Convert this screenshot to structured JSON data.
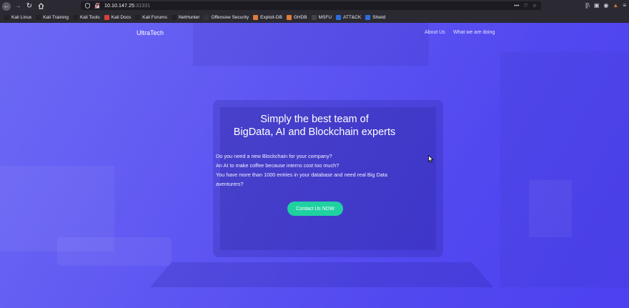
{
  "browser": {
    "url_host": "10.10.147.25",
    "url_port": ":31331",
    "bookmarks": [
      {
        "label": "Kali Linux",
        "icon": "kali-icon",
        "color": "#222222"
      },
      {
        "label": "Kali Training",
        "icon": "kali-icon",
        "color": "#222222"
      },
      {
        "label": "Kali Tools",
        "icon": "kali-icon",
        "color": "#222222"
      },
      {
        "label": "Kali Docs",
        "icon": "kali-docs-icon",
        "color": "#d9423b"
      },
      {
        "label": "Kali Forums",
        "icon": "kali-icon",
        "color": "#222222"
      },
      {
        "label": "NetHunter",
        "icon": "kali-icon",
        "color": "#222222"
      },
      {
        "label": "Offensive Security",
        "icon": "offsec-icon",
        "color": "#333333"
      },
      {
        "label": "Exploit-DB",
        "icon": "exploitdb-icon",
        "color": "#e07b39"
      },
      {
        "label": "GHDB",
        "icon": "ghdb-icon",
        "color": "#e07b39"
      },
      {
        "label": "MSFU",
        "icon": "msfu-icon",
        "color": "#444444"
      },
      {
        "label": "ATT&CK",
        "icon": "mitre-icon",
        "color": "#2d6cdf"
      },
      {
        "label": "Shield",
        "icon": "mitre-icon",
        "color": "#2d6cdf"
      }
    ]
  },
  "site": {
    "logo": "UltraTech",
    "nav": {
      "about": "About Us",
      "doing": "What we are doing"
    },
    "hero": {
      "title_line1": "Simply the best team of",
      "title_line2": "BigData, AI and Blockchain experts",
      "lines": [
        "Do you need a new Blockchain for your company?",
        "An AI to make coffee because interns cost too much?",
        "You have more than 1000 entries in your database and need real Big Data",
        "aventurers?"
      ],
      "cta": "Contact Us NOW"
    }
  },
  "colors": {
    "accent": "#1fd1a0",
    "hero_bg_start": "#6b66f5",
    "hero_bg_end": "#4a3ef0",
    "chrome": "#2b2a33"
  }
}
